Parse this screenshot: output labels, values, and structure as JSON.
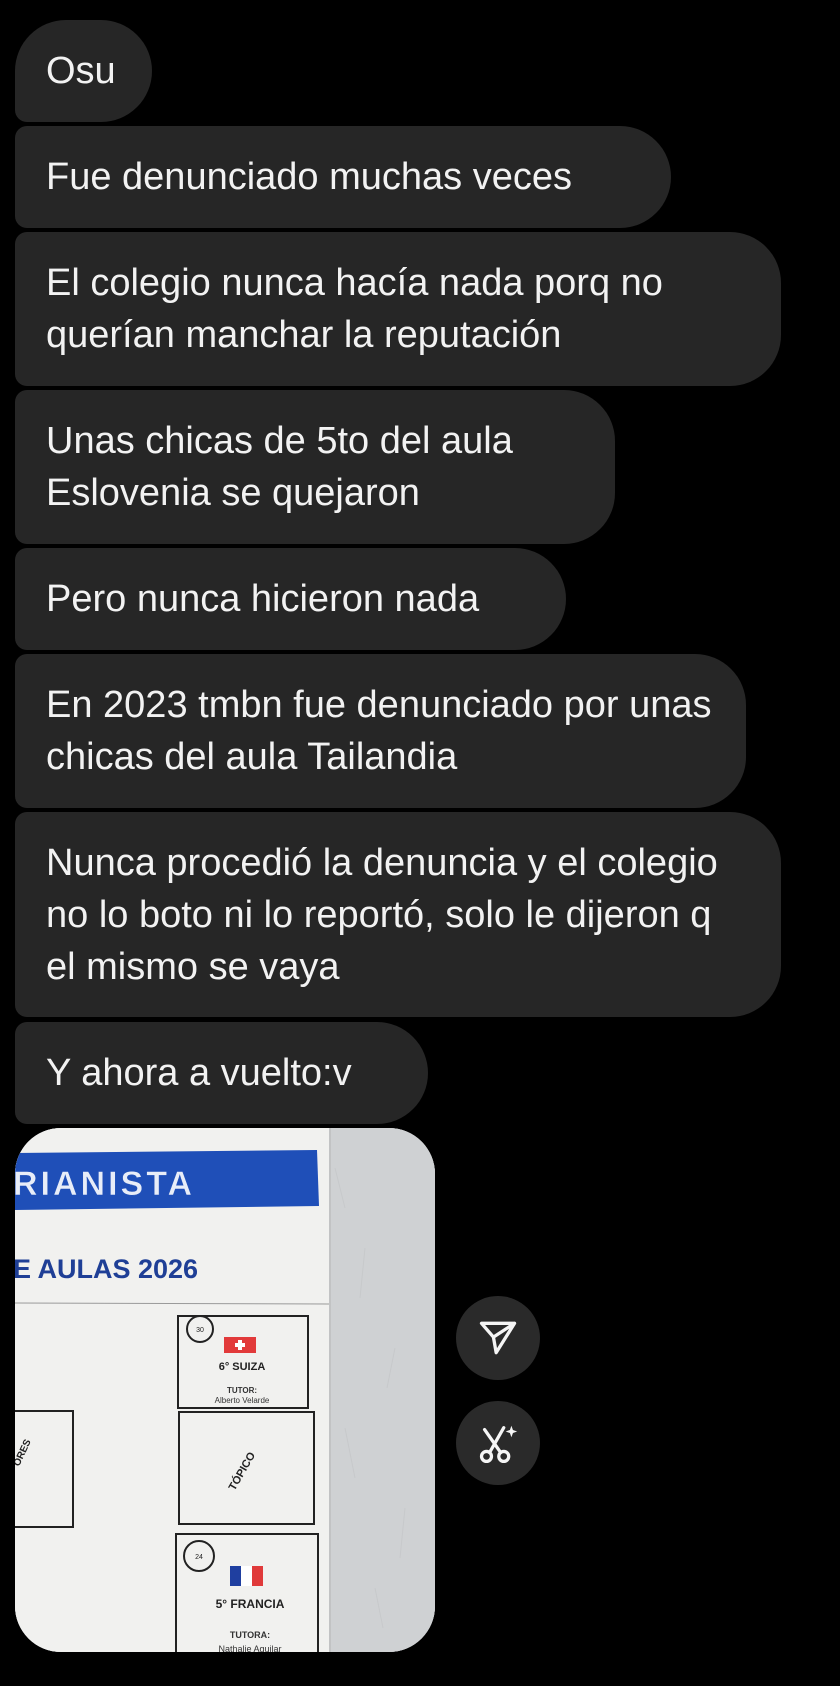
{
  "messages": [
    {
      "text": "Osu"
    },
    {
      "text": "Fue denunciado muchas veces"
    },
    {
      "text": "El colegio nunca hacía nada porq no querían manchar la reputación"
    },
    {
      "text": "Unas chicas de 5to del aula Eslovenia se quejaron"
    },
    {
      "text": "Pero nunca hicieron nada"
    },
    {
      "text": "En 2023 tmbn fue denunciado por unas chicas del aula Tailandia"
    },
    {
      "text": "Nunca procedió la denuncia y el colegio no lo boto ni lo reportó, solo le dijeron q el mismo se vaya"
    },
    {
      "text": "Y ahora a vuelto:v"
    }
  ],
  "photo": {
    "banner_text": "RIANISTA",
    "heading": "E AULAS 2026",
    "rooms": [
      {
        "number": "30",
        "name": "6° SUIZA",
        "tutor_label": "TUTOR:",
        "tutor_name": "Alberto Velarde"
      },
      {
        "name": "TÓPICO"
      },
      {
        "number": "24",
        "name": "5° FRANCIA",
        "tutor_label": "TUTORA:",
        "tutor_name": "Nathalie Aguilar"
      }
    ],
    "left_room_label": "ORES"
  },
  "actions": {
    "share_icon": "paper-plane-icon",
    "ai_icon": "scissors-sparkle-icon"
  },
  "colors": {
    "background": "#000000",
    "bubble": "#262626",
    "text": "#f2f2f2",
    "banner": "#1f4fb8"
  }
}
